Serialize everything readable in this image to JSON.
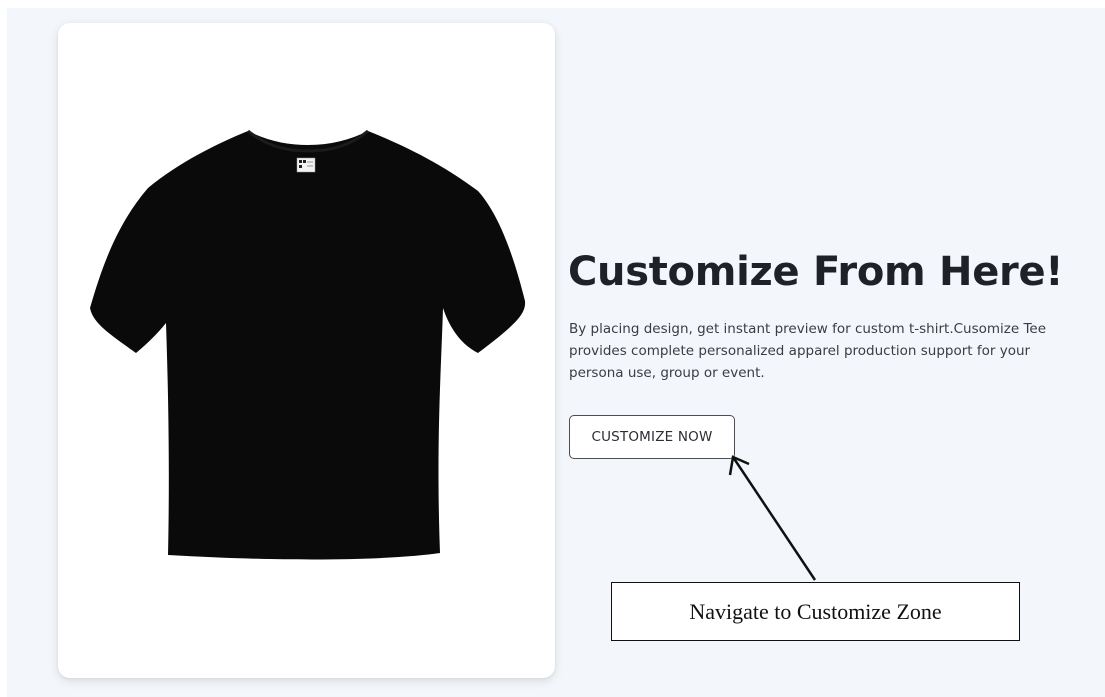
{
  "hero": {
    "title": "Customize From Here!",
    "description": "By placing design, get instant preview for custom t-shirt.Cusomize Tee provides complete personalized apparel production support for your persona use, group or event.",
    "button_label": "CUSTOMIZE NOW"
  },
  "product": {
    "color": "#0a0a0a"
  },
  "annotation": {
    "label": "Navigate to Customize Zone"
  },
  "colors": {
    "page_background": "#f3f6fa",
    "card_background": "#ffffff",
    "title_text": "#1f2128"
  }
}
